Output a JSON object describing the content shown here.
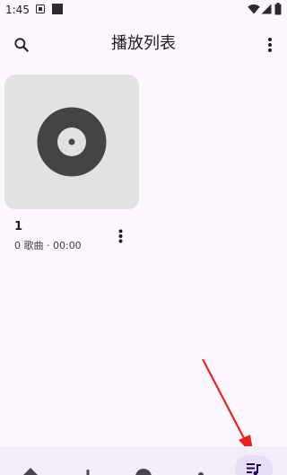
{
  "status_bar": {
    "time": "1:45",
    "icons": [
      "notification-a-icon",
      "notification-square-icon",
      "wifi-icon",
      "signal-icon",
      "battery-icon"
    ]
  },
  "top_bar": {
    "title": "播放列表",
    "left_icon": "search-icon",
    "right_icon": "more-vert-icon"
  },
  "playlists": [
    {
      "name": "1",
      "meta": "0 歌曲 · 00:00",
      "cover_icon": "vinyl-record-icon",
      "menu_icon": "more-vert-icon"
    }
  ],
  "bottom_nav": {
    "items": [
      {
        "icon": "home-icon",
        "selected": false
      },
      {
        "icon": "songs-icon",
        "selected": false
      },
      {
        "icon": "search-icon",
        "selected": false
      },
      {
        "icon": "profile-icon",
        "selected": false
      },
      {
        "icon": "playlist-icon",
        "selected": true
      }
    ]
  },
  "colors": {
    "background": "#fdf7ff",
    "cover": "#e3e2e3",
    "nav_background": "#f3edf7",
    "nav_indicator": "#e8def8",
    "accent": "#6750a4",
    "annotation": "#e8261f"
  }
}
